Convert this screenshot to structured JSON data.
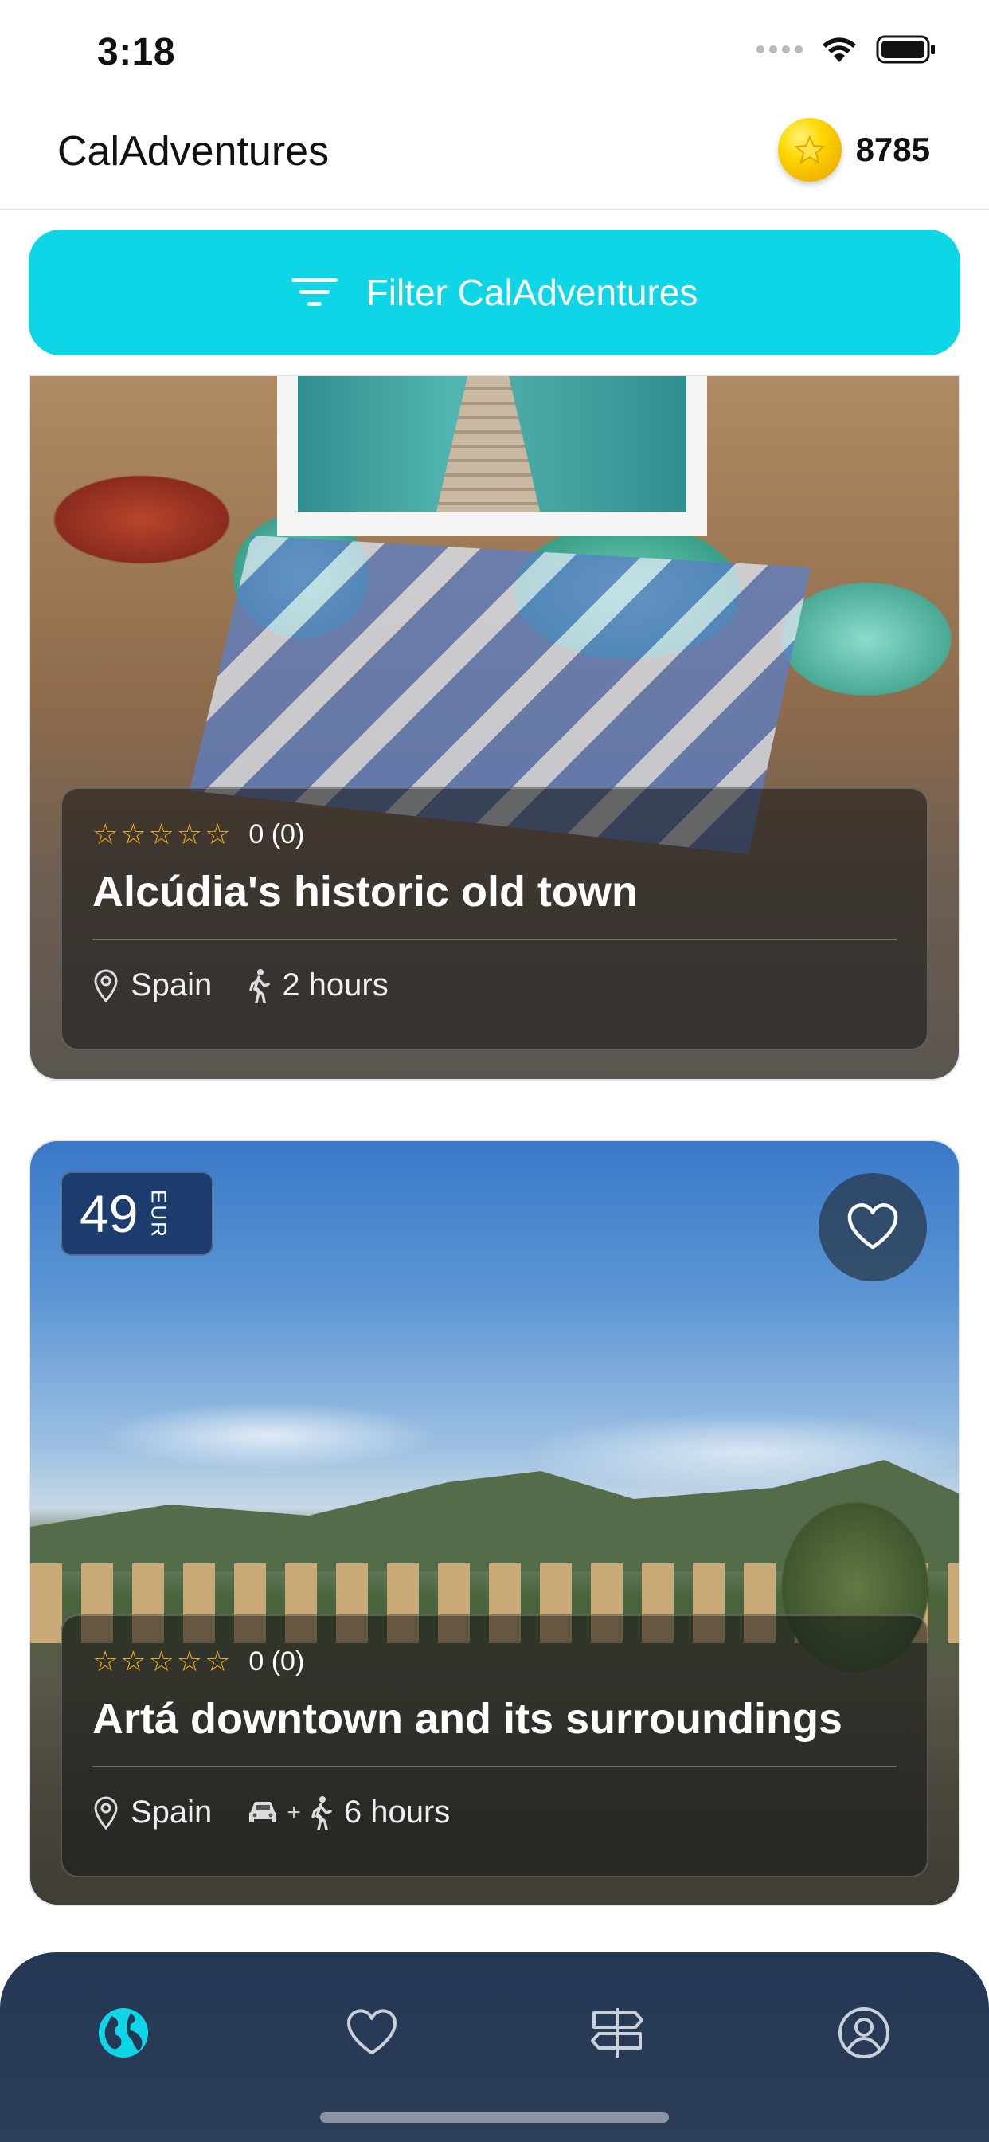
{
  "status_bar": {
    "time": "3:18"
  },
  "header": {
    "title": "CalAdventures",
    "coin_count": "8785"
  },
  "filter": {
    "label": "Filter CalAdventures"
  },
  "cards": [
    {
      "title": "Alcúdia's historic old town",
      "rating_text": "0 (0)",
      "stars": "☆☆☆☆☆",
      "location": "Spain",
      "duration": "2 hours"
    },
    {
      "title": "Artá downtown and its surroundings",
      "rating_text": "0 (0)",
      "stars": "☆☆☆☆☆",
      "location": "Spain",
      "duration": "6 hours",
      "price": "49",
      "currency": "EUR",
      "plus": "+"
    }
  ],
  "tabs": [
    "explore",
    "favorites",
    "tours",
    "profile"
  ],
  "colors": {
    "accent": "#0fd6e6",
    "tab_bar": "#243754",
    "star": "#f6b40e"
  }
}
